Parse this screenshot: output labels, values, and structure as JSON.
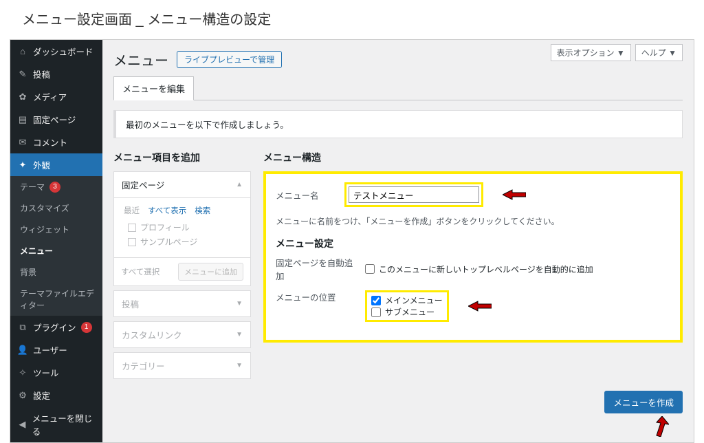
{
  "doc_title": "メニュー設定画面 _ メニュー構造の設定",
  "topright": {
    "screen_options": "表示オプション ▼",
    "help": "ヘルプ ▼"
  },
  "sidebar": {
    "dashboard": "ダッシュボード",
    "posts": "投稿",
    "media": "メディア",
    "pages": "固定ページ",
    "comments": "コメント",
    "appearance": "外観",
    "appearance_sub": {
      "themes": "テーマ",
      "themes_badge": "3",
      "customize": "カスタマイズ",
      "widgets": "ウィジェット",
      "menus": "メニュー",
      "background": "背景",
      "theme_editor": "テーマファイルエディター"
    },
    "plugins": "プラグイン",
    "plugins_badge": "1",
    "users": "ユーザー",
    "tools": "ツール",
    "settings": "設定",
    "collapse": "メニューを閉じる"
  },
  "page": {
    "title": "メニュー",
    "preview_btn": "ライブプレビューで管理",
    "tab_edit": "メニューを編集",
    "notice": "最初のメニューを以下で作成しましょう。"
  },
  "left": {
    "heading": "メニュー項目を追加",
    "acc1": "固定ページ",
    "subtab_recent": "最近",
    "subtab_all": "すべて表示",
    "subtab_search": "検索",
    "item_profile": "プロフィール",
    "item_sample": "サンプルページ",
    "select_all": "すべて選択",
    "add_to_menu": "メニューに追加",
    "acc2": "投稿",
    "acc3": "カスタムリンク",
    "acc4": "カテゴリー"
  },
  "right": {
    "heading": "メニュー構造",
    "name_label": "メニュー名",
    "name_value": "テストメニュー",
    "help": "メニューに名前をつけ、「メニューを作成」ボタンをクリックしてください。",
    "settings_heading": "メニュー設定",
    "auto_add_label": "固定ページを自動追加",
    "auto_add_opt": "このメニューに新しいトップレベルページを自動的に追加",
    "location_label": "メニューの位置",
    "loc_main": "メインメニュー",
    "loc_sub": "サブメニュー",
    "create_btn": "メニューを作成"
  }
}
